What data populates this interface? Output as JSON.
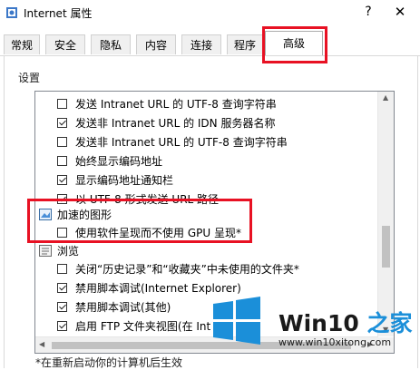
{
  "window": {
    "title": "Internet 属性",
    "help": "?",
    "close": "✕"
  },
  "tabs": [
    "常规",
    "安全",
    "隐私",
    "内容",
    "连接",
    "程序",
    "高级"
  ],
  "settings_label": "设置",
  "tree": {
    "items": [
      {
        "kind": "check",
        "checked": false,
        "label": "发送 Intranet URL 的 UTF-8 查询字符串"
      },
      {
        "kind": "check",
        "checked": true,
        "label": "发送非 Intranet URL 的 IDN 服务器名称"
      },
      {
        "kind": "check",
        "checked": false,
        "label": "发送非 Intranet URL 的 UTF-8 查询字符串"
      },
      {
        "kind": "check",
        "checked": false,
        "label": "始终显示编码地址"
      },
      {
        "kind": "check",
        "checked": true,
        "label": "显示编码地址通知栏"
      },
      {
        "kind": "check",
        "checked": true,
        "label": "以 UTF-8 形式发送 URL 路径"
      },
      {
        "kind": "category",
        "icon": "accelerated-graphics-icon",
        "label": "加速的图形"
      },
      {
        "kind": "check",
        "checked": false,
        "label": "使用软件呈现而不使用 GPU 呈现*"
      },
      {
        "kind": "category",
        "icon": "browsing-icon",
        "label": "浏览"
      },
      {
        "kind": "check",
        "checked": false,
        "label": "关闭“历史记录”和“收藏夹”中未使用的文件夹*"
      },
      {
        "kind": "check",
        "checked": true,
        "label": "禁用脚本调试(Internet Explorer)"
      },
      {
        "kind": "check",
        "checked": true,
        "label": "禁用脚本调试(其他)"
      },
      {
        "kind": "check",
        "checked": true,
        "label": "启用 FTP 文件夹视图(在 Int"
      }
    ]
  },
  "footer_note": "*在重新启动你的计算机后生效",
  "watermark": {
    "brand_prefix": "Win10 ",
    "brand_suffix": "之家",
    "url": "www.win10xitong.com"
  },
  "colors": {
    "highlight_red": "#e81123",
    "accent_blue": "#1b8fd9"
  }
}
